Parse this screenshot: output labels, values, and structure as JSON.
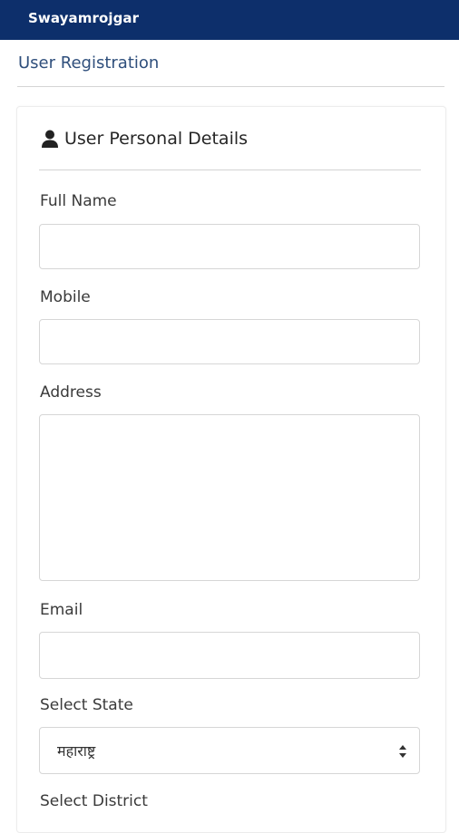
{
  "header": {
    "app_title": "Swayamrojgar",
    "bar_color": "#0d2f6b"
  },
  "page": {
    "title": "User Registration"
  },
  "section": {
    "title": "User Personal Details",
    "icon": "user-icon"
  },
  "form": {
    "full_name": {
      "label": "Full Name",
      "value": ""
    },
    "mobile": {
      "label": "Mobile",
      "value": ""
    },
    "address": {
      "label": "Address",
      "value": ""
    },
    "email": {
      "label": "Email",
      "value": ""
    },
    "state": {
      "label": "Select State",
      "selected": "महाराष्ट्र"
    },
    "district": {
      "label": "Select District"
    }
  }
}
